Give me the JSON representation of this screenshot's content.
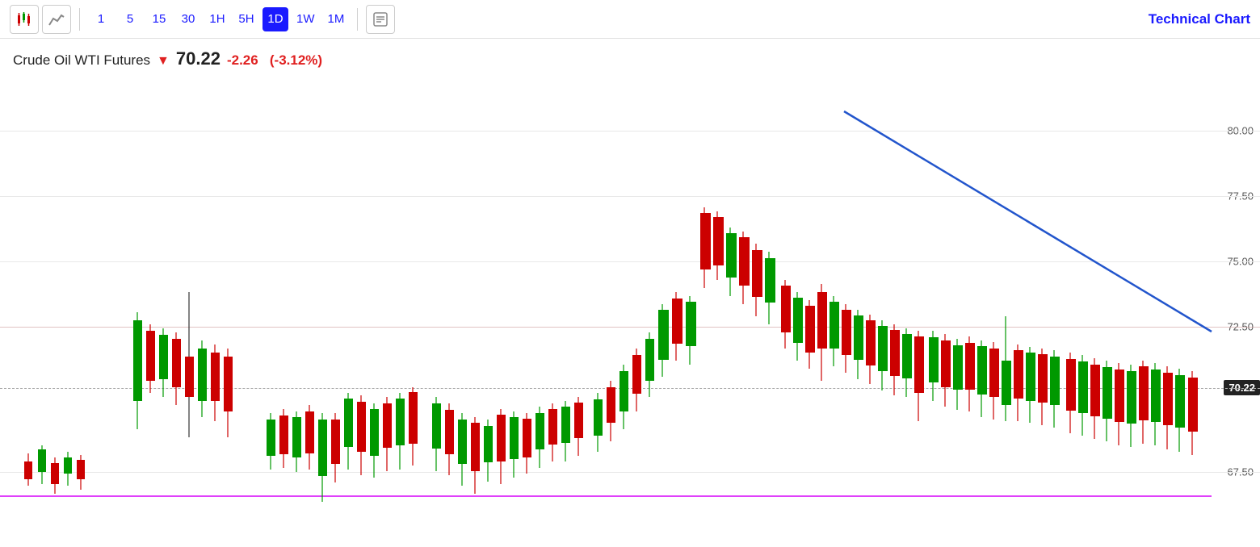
{
  "toolbar": {
    "chart_icon_label": "candlestick-chart",
    "line_icon_label": "line-chart",
    "timeframes": [
      "1",
      "5",
      "15",
      "30",
      "1H",
      "5H",
      "1D",
      "1W",
      "1M"
    ],
    "active_timeframe": "1D",
    "news_icon_label": "news",
    "technical_chart_label": "Technical Chart"
  },
  "price_header": {
    "instrument": "Crude Oil WTI Futures",
    "price": "70.22",
    "change": "-2.26",
    "change_pct": "(-3.12%)"
  },
  "chart": {
    "price_levels": [
      {
        "price": "80.00",
        "y_pct": 12
      },
      {
        "price": "77.50",
        "y_pct": 26
      },
      {
        "price": "75.00",
        "y_pct": 40
      },
      {
        "price": "72.50",
        "y_pct": 54
      },
      {
        "price": "70.22",
        "y_pct": 67
      },
      {
        "price": "67.50",
        "y_pct": 82
      }
    ],
    "current_price": "70.22",
    "current_price_y_pct": 67,
    "dashed_line_y_pct": 67,
    "support_line_y_pct": 90,
    "trendline": {
      "x1_pct": 67,
      "y1_pct": 8,
      "x2_pct": 96,
      "y2_pct": 55,
      "color": "#2255cc",
      "width": 2.5
    }
  }
}
